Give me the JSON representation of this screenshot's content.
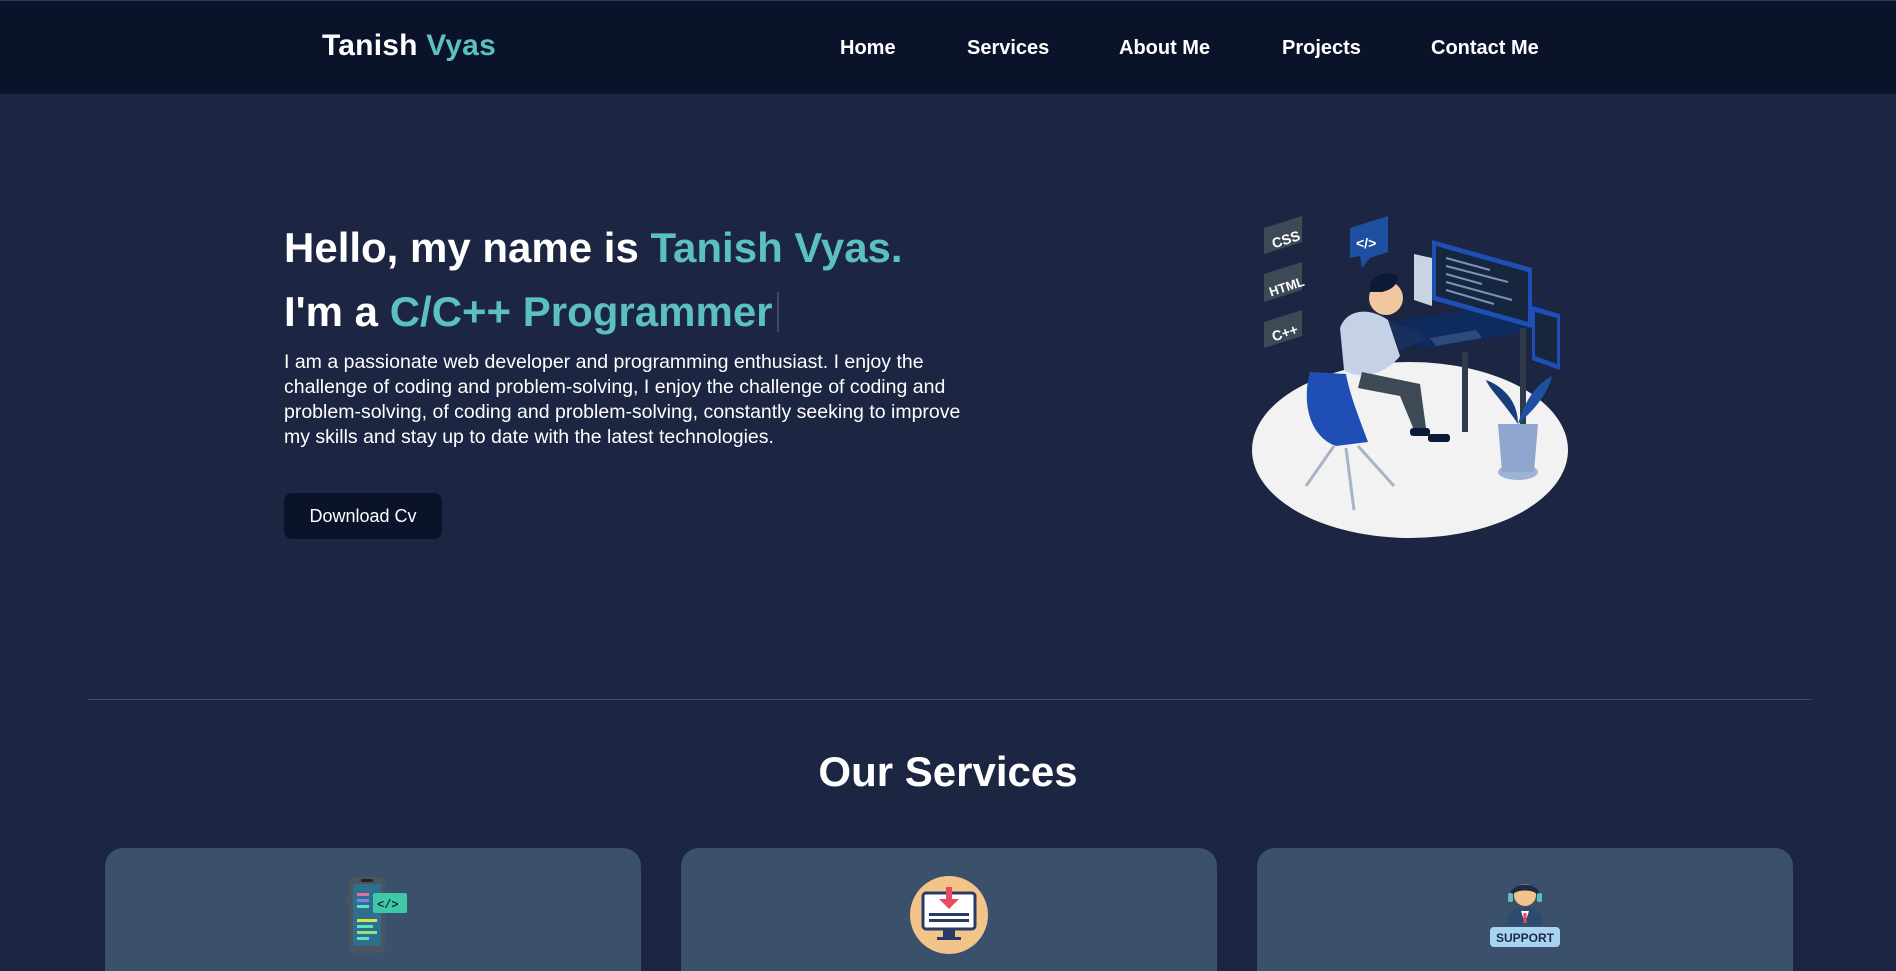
{
  "nav": {
    "brand_first": "Tanish",
    "brand_accent": "Vyas",
    "links": {
      "home": "Home",
      "services": "Services",
      "about": "About Me",
      "projects": "Projects",
      "contact": "Contact Me"
    }
  },
  "hero": {
    "greeting_prefix": "Hello, my name is ",
    "greeting_name": "Tanish Vyas.",
    "role_prefix": "I'm a ",
    "role_value": "C/C++ Programmer",
    "description": "I am a passionate web developer and programming enthusiast. I enjoy the challenge of coding and problem-solving, I enjoy the challenge of coding and problem-solving, of coding and problem-solving, constantly seeking to improve my skills and stay up to date with the latest technologies.",
    "cv_button": "Download Cv",
    "illustration_tags": [
      "CSS",
      "HTML",
      "C++",
      "</>"
    ]
  },
  "services": {
    "title": "Our Services",
    "cards": [
      {
        "icon": "mobile-code-icon"
      },
      {
        "icon": "download-monitor-icon"
      },
      {
        "icon": "support-agent-icon",
        "badge": "SUPPORT"
      }
    ]
  },
  "colors": {
    "nav_bg": "#0b132b",
    "page_bg": "#1c2541",
    "accent": "#5bc0be",
    "card_bg": "#3a506b"
  }
}
